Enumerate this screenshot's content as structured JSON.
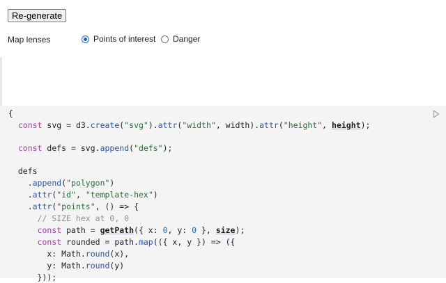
{
  "toolbar": {
    "regenerate_label": "Re-generate"
  },
  "lenses": {
    "label": "Map lenses",
    "options": [
      {
        "label": "Points of interest",
        "selected": true
      },
      {
        "label": "Danger",
        "selected": false
      }
    ]
  },
  "code": {
    "lines": [
      "{",
      "  const svg = d3.create(\"svg\").attr(\"width\", width).attr(\"height\", height);",
      "",
      "  const defs = svg.append(\"defs\");",
      "",
      "  defs",
      "    .append(\"polygon\")",
      "    .attr(\"id\", \"template-hex\")",
      "    .attr(\"points\", () => {",
      "      // SIZE hex at 0, 0",
      "      const path = getPath({ x: 0, y: 0 }, size);",
      "      const rounded = path.map(({ x, y }) => ({",
      "        x: Math.round(x),",
      "        y: Math.round(y)",
      "      }));"
    ]
  },
  "colors": {
    "accent": "#1a5fd0",
    "code_bg": "#f4f4f4",
    "keyword": "#a33ba3",
    "string": "#2b6a3b",
    "function": "#2d55a6"
  },
  "icons": {
    "run": "play-icon"
  }
}
